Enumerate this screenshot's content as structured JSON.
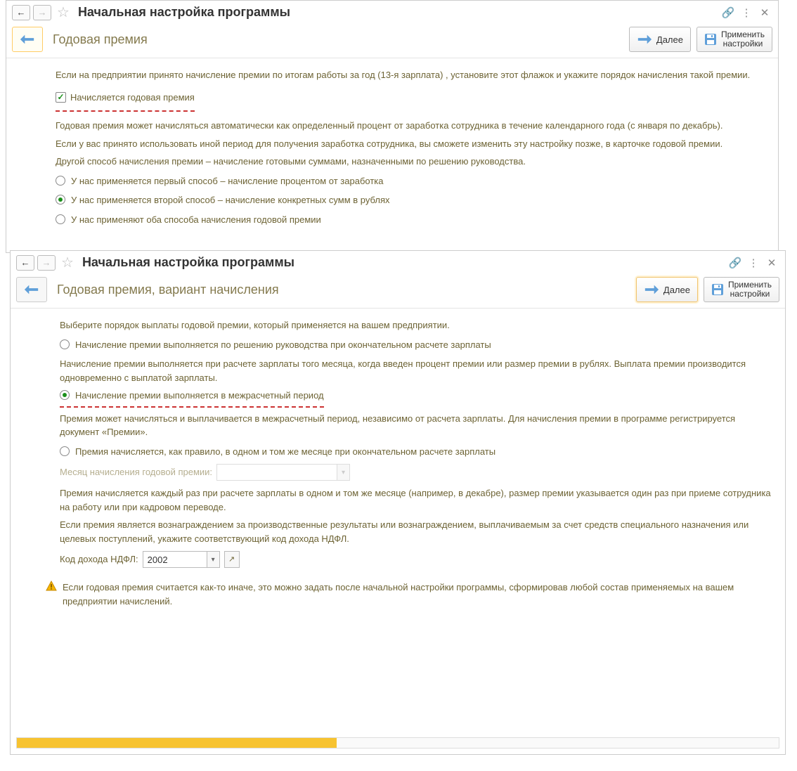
{
  "win1": {
    "title": "Начальная настройка программы",
    "section": "Годовая премия",
    "btn_next": "Далее",
    "btn_apply_l1": "Применить",
    "btn_apply_l2": "настройки",
    "intro": "Если на предприятии принято начисление премии по итогам работы за год (13-я зарплата) , установите этот флажок и укажите порядок начисления такой премии.",
    "checkbox": "Начисляется годовая премия",
    "p2": "Годовая премия может начисляться автоматически как определенный процент от заработка сотрудника в течение календарного года (с января по декабрь).",
    "p3": "Если у вас принято использовать иной период для получения заработка сотрудника, вы сможете изменить эту настройку позже, в карточке годовой премии.",
    "p4": "Другой способ начисления премии – начисление готовыми суммами, назначенными по решению руководства.",
    "r1": "У нас применяется первый способ – начисление процентом от заработка",
    "r2": "У нас применяется второй способ – начисление конкретных сумм в рублях",
    "r3": "У нас применяют оба способа начисления годовой премии"
  },
  "win2": {
    "title": "Начальная настройка программы",
    "section": "Годовая премия,  вариант начисления",
    "btn_next": "Далее",
    "btn_apply_l1": "Применить",
    "btn_apply_l2": "настройки",
    "intro": "Выберите порядок выплаты годовой премии, который применяется на вашем предприятии.",
    "r1": "Начисление премии выполняется по решению руководства при окончательном расчете зарплаты",
    "p2": "Начисление премии выполняется при расчете зарплаты того месяца, когда введен процент премии или размер премии в рублях. Выплата премии производится одновременно с выплатой зарплаты.",
    "r2": "Начисление премии выполняется в межрасчетный период",
    "p3": "Премия может начисляться и выплачивается в межрасчетный период, независимо от расчета зарплаты. Для начисления премии в программе регистрируется документ «Премии».",
    "r3": "Премия начисляется, как правило, в одном и том же месяце при окончательном расчете зарплаты",
    "month_label": "Месяц начисления годовой премии:",
    "p4": "Премия начисляется каждый раз при расчете зарплаты в одном и том же месяце (например, в декабре), размер премии указывается один раз при приеме сотрудника на работу или при кадровом переводе.",
    "p5": "Если премия является вознаграждением за производственные результаты или вознаграждением, выплачиваемым за счет средств специального назначения или целевых поступлений, укажите соответствующий код дохода НДФЛ.",
    "ndfl_label": "Код дохода НДФЛ:",
    "ndfl_value": "2002",
    "warn": "Если годовая премия считается как-то иначе, это можно задать после начальной настройки программы, сформировав любой состав применяемых на вашем предприятии начислений.",
    "progress_pct": 42
  }
}
